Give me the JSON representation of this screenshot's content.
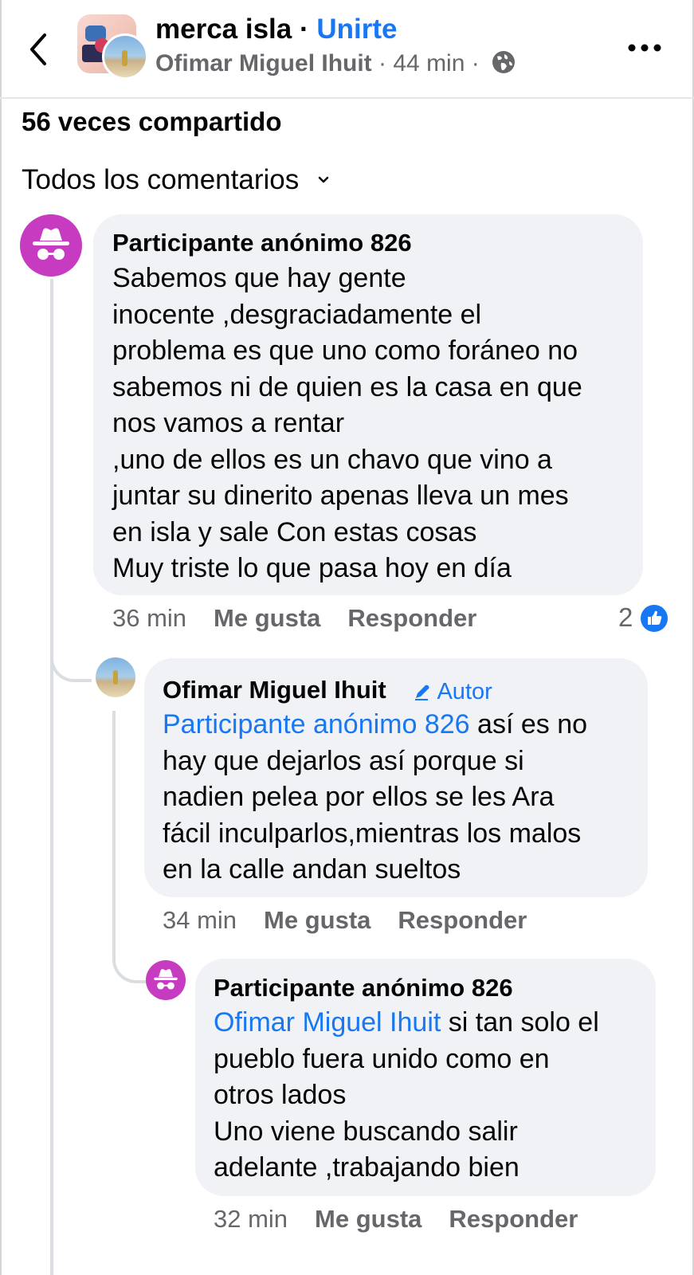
{
  "header": {
    "group_name": "merca isla",
    "separator": " · ",
    "join_label": "Unirte",
    "author": "Ofimar Miguel Ihuit",
    "time": "44 min",
    "dot": "·"
  },
  "post": {
    "shares": "56 veces compartido",
    "filter_label": "Todos los comentarios"
  },
  "comments": [
    {
      "author": "Participante anónimo 826",
      "lines": [
        "Sabemos que hay gente",
        "inocente ,desgraciadamente el",
        "problema es que uno como foráneo no",
        "sabemos ni de quien es la casa en que",
        "nos vamos a rentar",
        ",uno de ellos es un chavo que vino a",
        "juntar su dinerito apenas lleva un mes",
        "en isla y sale Con estas cosas",
        "Muy triste lo que pasa hoy en día"
      ],
      "time": "36 min",
      "like": "Me gusta",
      "reply": "Responder",
      "reactions": "2"
    },
    {
      "author": "Ofimar Miguel Ihuit",
      "badge": "Autor",
      "mention": "Participante anónimo 826",
      "first_line_rest": " así es no",
      "lines": [
        "hay que dejarlos así porque si",
        "nadien pelea por ellos se les Ara",
        "fácil inculparlos,mientras los malos",
        "en la calle andan sueltos"
      ],
      "time": "34 min",
      "like": "Me gusta",
      "reply": "Responder"
    },
    {
      "author": "Participante anónimo 826",
      "mention": "Ofimar Miguel Ihuit",
      "first_line_rest": " si tan solo el",
      "lines": [
        "pueblo fuera unido como en",
        "otros lados",
        "Uno viene buscando salir",
        "adelante ,trabajando bien"
      ],
      "time": "32 min",
      "like": "Me gusta",
      "reply": "Responder"
    }
  ],
  "colors": {
    "accent": "#1877f2",
    "anon_avatar": "#c63bc0",
    "bubble": "#f0f2f5",
    "secondary_text": "#65676b"
  },
  "icons": [
    "back-arrow-icon",
    "globe-icon",
    "more-icon",
    "chevron-down-icon",
    "incognito-icon",
    "pencil-icon",
    "like-reaction-icon"
  ]
}
